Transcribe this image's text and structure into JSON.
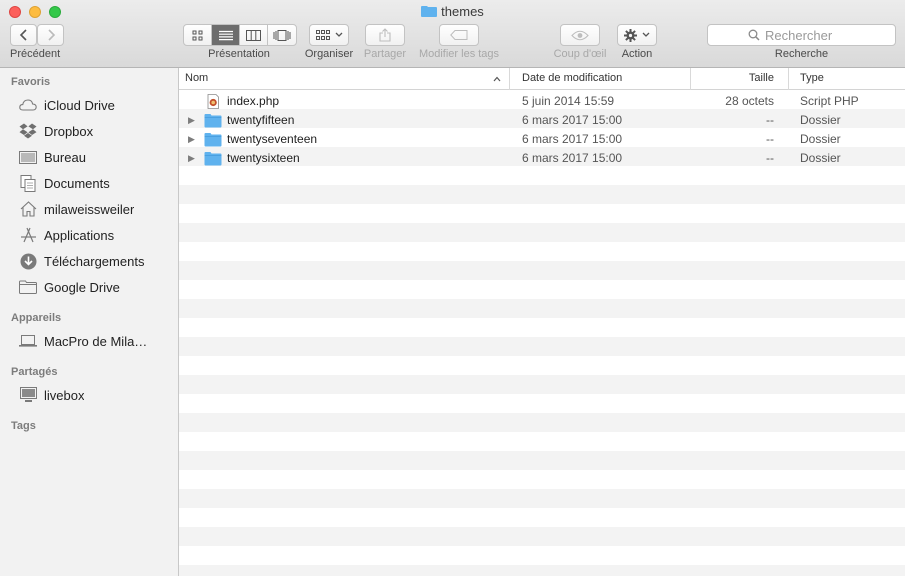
{
  "window": {
    "title": "themes"
  },
  "toolbar": {
    "back_label": "Précédent",
    "view_label": "Présentation",
    "arrange_label": "Organiser",
    "share_label": "Partager",
    "tags_label": "Modifier les tags",
    "quicklook_label": "Coup d'œil",
    "action_label": "Action",
    "search_label": "Recherche",
    "search_placeholder": "Rechercher"
  },
  "sidebar": {
    "favorites_heading": "Favoris",
    "favorites": [
      {
        "label": "iCloud Drive",
        "icon": "cloud-icon"
      },
      {
        "label": "Dropbox",
        "icon": "dropbox-icon"
      },
      {
        "label": "Bureau",
        "icon": "desktop-icon"
      },
      {
        "label": "Documents",
        "icon": "documents-icon"
      },
      {
        "label": "milaweissweiler",
        "icon": "home-icon"
      },
      {
        "label": "Applications",
        "icon": "applications-icon"
      },
      {
        "label": "Téléchargements",
        "icon": "downloads-icon"
      },
      {
        "label": "Google Drive",
        "icon": "folder-icon"
      }
    ],
    "devices_heading": "Appareils",
    "devices": [
      {
        "label": "MacPro de Mila…",
        "icon": "laptop-icon"
      }
    ],
    "shared_heading": "Partagés",
    "shared": [
      {
        "label": "livebox",
        "icon": "monitor-icon"
      }
    ],
    "tags_heading": "Tags"
  },
  "columns": {
    "name": "Nom",
    "date": "Date de modification",
    "size": "Taille",
    "type": "Type"
  },
  "files": [
    {
      "name": "index.php",
      "date": "5 juin 2014 15:59",
      "size": "28 octets",
      "type": "Script PHP",
      "kind": "php-file-icon"
    },
    {
      "name": "twentyfifteen",
      "date": "6 mars 2017 15:00",
      "size": "--",
      "type": "Dossier",
      "kind": "folder-icon"
    },
    {
      "name": "twentyseventeen",
      "date": "6 mars 2017 15:00",
      "size": "--",
      "type": "Dossier",
      "kind": "folder-icon"
    },
    {
      "name": "twentysixteen",
      "date": "6 mars 2017 15:00",
      "size": "--",
      "type": "Dossier",
      "kind": "folder-icon"
    }
  ],
  "colors": {
    "folder": "#5fb2ee",
    "sidebar_bg": "#f2f2f2",
    "stripe": "#f3f3f3"
  }
}
